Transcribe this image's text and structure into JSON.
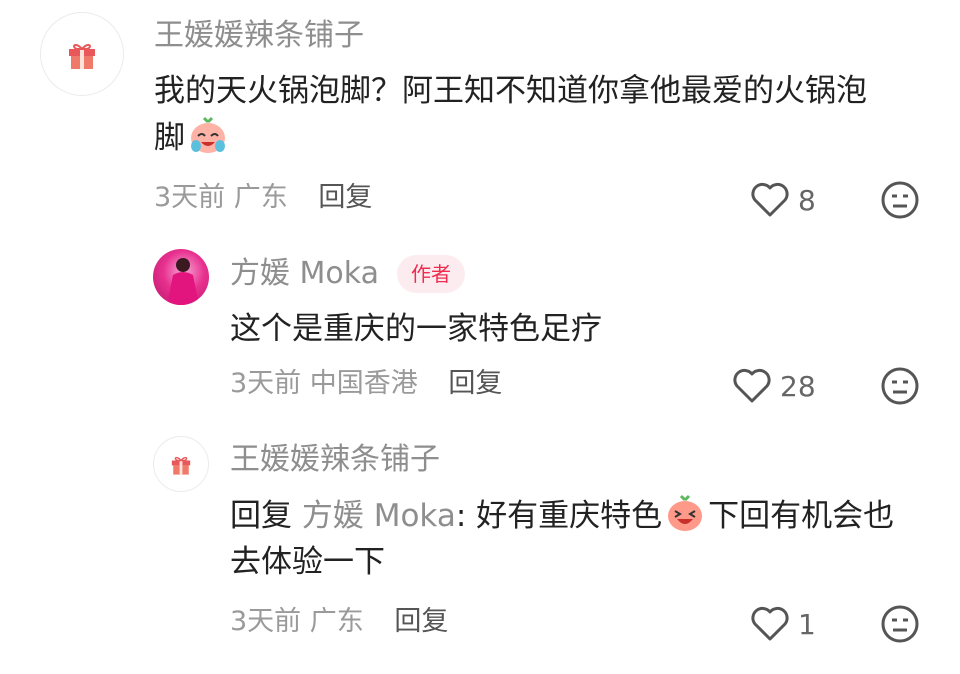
{
  "comments": [
    {
      "name": "王媛媛辣条铺子",
      "text_1": "我的天火锅泡脚？阿王知不知道你拿他最爱的火锅泡",
      "text_2": "脚",
      "time": "3天前",
      "location": "广东",
      "reply_label": "回复",
      "likes": "8"
    },
    {
      "name": "方媛 Moka",
      "tag": "作者",
      "text": "这个是重庆的一家特色足疗",
      "time": "3天前",
      "location": "中国香港",
      "reply_label": "回复",
      "likes": "28"
    },
    {
      "name": "王媛媛辣条铺子",
      "reply_prefix": "回复",
      "mention": "方媛 Moka",
      "colon": ": ",
      "text_1a": "好有重庆特色",
      "text_1b": "下回有机会也",
      "text_2": "去体验一下",
      "time": "3天前",
      "location": "广东",
      "reply_label": "回复",
      "likes": "1"
    }
  ],
  "icons": {
    "gift": "gift-icon",
    "heart": "heart-icon",
    "dislike": "dislike-face-icon",
    "cry_emoji": "crying-laughing-emoji",
    "laugh_emoji": "laughing-emoji"
  },
  "colors": {
    "accent": "#ee2c4f",
    "muted": "#8e8e8e"
  }
}
